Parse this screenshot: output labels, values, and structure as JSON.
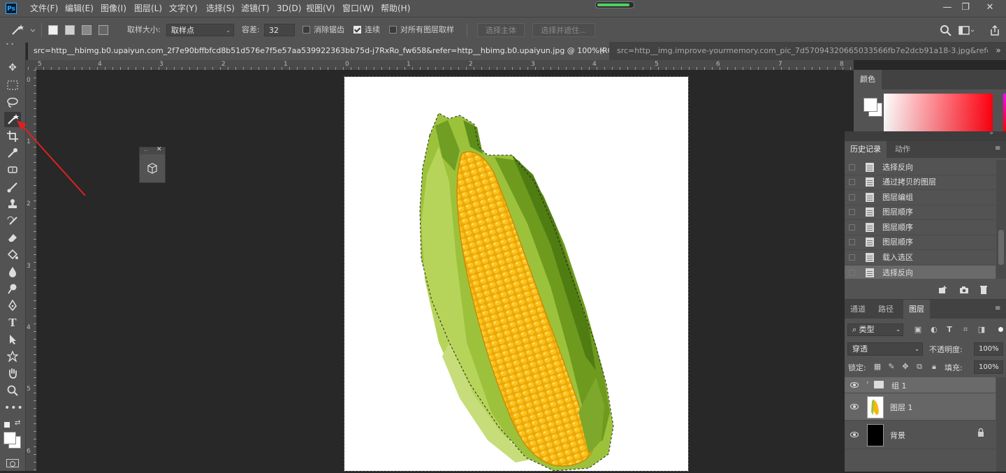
{
  "app": {
    "logo": "Ps"
  },
  "menu": {
    "items": [
      "文件(F)",
      "编辑(E)",
      "图像(I)",
      "图层(L)",
      "文字(Y)",
      "选择(S)",
      "滤镜(T)",
      "3D(D)",
      "视图(V)",
      "窗口(W)",
      "帮助(H)"
    ]
  },
  "window_controls": {
    "minimize": "—",
    "restore": "❐",
    "close": "✕"
  },
  "options": {
    "sample_size_label": "取样大小:",
    "sample_size_value": "取样点",
    "tolerance_label": "容差:",
    "tolerance_value": "32",
    "antialias_label": "消除锯齿",
    "antialias_checked": false,
    "contiguous_label": "连续",
    "contiguous_checked": true,
    "all_layers_label": "对所有图层取样",
    "all_layers_checked": false,
    "select_subject_label": "选择主体",
    "select_mask_label": "选择并遮住..."
  },
  "tabs": [
    {
      "label": "src=http__hbimg.b0.upaiyun.com_2f7e90bffbfcd8b51d576e7f5e57aa539922363bb75d-j7RxRo_fw658&refer=http__hbimg.b0.upaiyun.jpg @ 100%(RGB/8) *",
      "close": "×",
      "active": true
    },
    {
      "label": "src=http__img.improve-yourmemory.com_pic_7d57094320665033566fb7e2dcb91a18-3.jpg&refer=http_",
      "close": "»",
      "active": false
    }
  ],
  "ruler": {
    "h_labels": [
      "5",
      "4",
      "3",
      "2",
      "1",
      "0",
      "1",
      "2",
      "3",
      "4",
      "5",
      "6",
      "7",
      "8"
    ],
    "v_labels": [
      "0",
      "1",
      "2",
      "3",
      "4",
      "5",
      "6"
    ]
  },
  "color_panel": {
    "title": "颜色"
  },
  "history_panel": {
    "tabs": [
      "历史记录",
      "动作"
    ],
    "items": [
      "选择反向",
      "通过拷贝的图层",
      "图层编组",
      "图层顺序",
      "图层顺序",
      "图层顺序",
      "载入选区",
      "选择反向"
    ],
    "selected_index": 7
  },
  "layers_panel": {
    "tabs": [
      "通道",
      "路径",
      "图层"
    ],
    "filter_label": "类型",
    "blend_mode": "穿透",
    "opacity_label": "不透明度:",
    "opacity_value": "100%",
    "lock_label": "锁定:",
    "fill_label": "填充:",
    "fill_value": "100%",
    "layers": [
      {
        "name": "组 1",
        "kind": "group"
      },
      {
        "name": "图层 1",
        "kind": "image"
      },
      {
        "name": "背景",
        "kind": "background",
        "locked": true
      }
    ]
  },
  "colors": {
    "ui_dark": "#535353",
    "canvas_bg": "#282828",
    "accent_blue": "#31a8ff",
    "corn_yellow": "#f4b80f",
    "husk_green": "#9cc23c"
  }
}
